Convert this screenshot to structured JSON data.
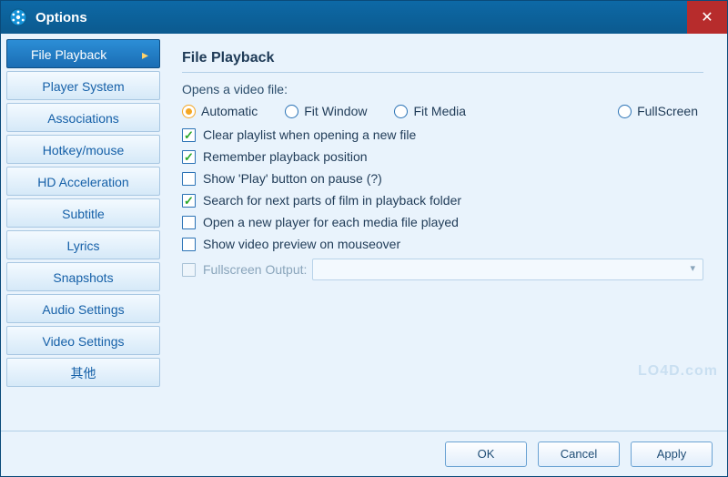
{
  "window": {
    "title": "Options"
  },
  "sidebar": {
    "items": [
      {
        "label": "File Playback",
        "active": true
      },
      {
        "label": "Player System",
        "active": false
      },
      {
        "label": "Associations",
        "active": false
      },
      {
        "label": "Hotkey/mouse",
        "active": false
      },
      {
        "label": "HD Acceleration",
        "active": false
      },
      {
        "label": "Subtitle",
        "active": false
      },
      {
        "label": "Lyrics",
        "active": false
      },
      {
        "label": "Snapshots",
        "active": false
      },
      {
        "label": "Audio Settings",
        "active": false
      },
      {
        "label": "Video Settings",
        "active": false
      },
      {
        "label": "其他",
        "active": false
      }
    ]
  },
  "panel": {
    "title": "File Playback",
    "opens_label": "Opens a video file:",
    "radio": {
      "automatic": "Automatic",
      "fit_window": "Fit Window",
      "fit_media": "Fit Media",
      "fullscreen": "FullScreen",
      "selected": "automatic"
    },
    "checks": [
      {
        "label": "Clear playlist when opening a new file",
        "checked": true,
        "disabled": false
      },
      {
        "label": "Remember playback position",
        "checked": true,
        "disabled": false
      },
      {
        "label": "Show 'Play' button on pause (?)",
        "checked": false,
        "disabled": false
      },
      {
        "label": "Search for next parts of film in playback folder",
        "checked": true,
        "disabled": false
      },
      {
        "label": "Open a new player for each media file played",
        "checked": false,
        "disabled": false
      },
      {
        "label": "Show video preview on mouseover",
        "checked": false,
        "disabled": false
      }
    ],
    "fullscreen_output": {
      "label": "Fullscreen Output:",
      "value": "",
      "disabled": true
    }
  },
  "footer": {
    "ok": "OK",
    "cancel": "Cancel",
    "apply": "Apply"
  },
  "watermark": "LO4D.com"
}
